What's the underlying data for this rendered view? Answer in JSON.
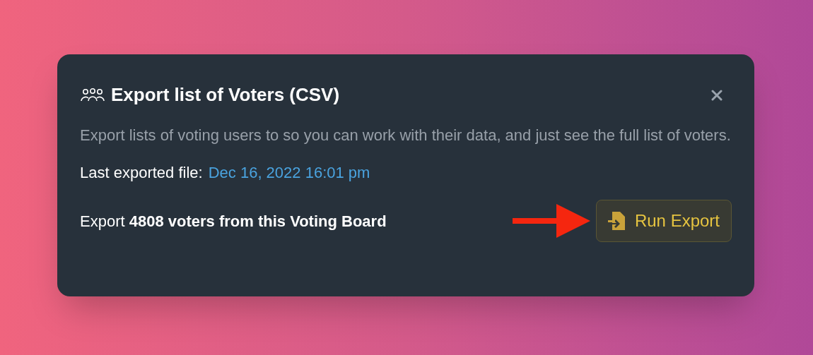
{
  "dialog": {
    "title": "Export list of Voters (CSV)",
    "description": "Export lists of voting users to so you can work with their data, and just see the full list of voters.",
    "last_export": {
      "label": "Last exported file:",
      "link": "Dec 16, 2022 16:01 pm"
    },
    "summary": "Export **4808 voters from this Voting Board**",
    "button": "Run Export"
  }
}
